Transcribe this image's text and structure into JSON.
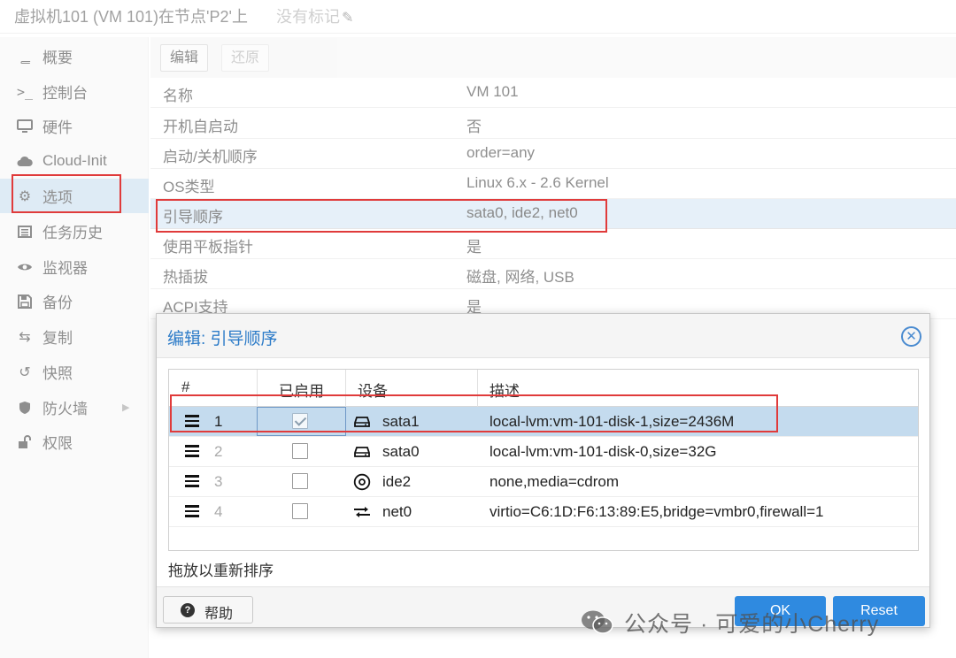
{
  "window": {
    "title": "虚拟机101 (VM 101)在节点'P2'上",
    "tags_label": "没有标记"
  },
  "nav": {
    "items": [
      {
        "label": "概要",
        "icon": "book-icon"
      },
      {
        "label": "控制台",
        "icon": "terminal-icon"
      },
      {
        "label": "硬件",
        "icon": "monitor-icon"
      },
      {
        "label": "Cloud-Init",
        "icon": "cloud-icon"
      },
      {
        "label": "选项",
        "icon": "gear-icon"
      },
      {
        "label": "任务历史",
        "icon": "list-icon"
      },
      {
        "label": "监视器",
        "icon": "eye-icon"
      },
      {
        "label": "备份",
        "icon": "floppy-icon"
      },
      {
        "label": "复制",
        "icon": "retweet-icon"
      },
      {
        "label": "快照",
        "icon": "history-icon"
      },
      {
        "label": "防火墙",
        "icon": "shield-icon"
      },
      {
        "label": "权限",
        "icon": "unlock-icon"
      }
    ]
  },
  "toolbar": {
    "edit_label": "编辑",
    "revert_label": "还原"
  },
  "options": {
    "rows": [
      {
        "key": "名称",
        "value": "VM 101"
      },
      {
        "key": "开机自启动",
        "value": "否"
      },
      {
        "key": "启动/关机顺序",
        "value": "order=any"
      },
      {
        "key": "OS类型",
        "value": "Linux 6.x - 2.6 Kernel"
      },
      {
        "key": "引导顺序",
        "value": "sata0, ide2, net0"
      },
      {
        "key": "使用平板指针",
        "value": "是"
      },
      {
        "key": "热插拔",
        "value": "磁盘, 网络, USB"
      },
      {
        "key": "ACPI支持",
        "value": "是"
      }
    ]
  },
  "dialog": {
    "title": "编辑: 引导顺序",
    "columns": {
      "num": "#",
      "enabled": "已启用",
      "device": "设备",
      "description": "描述"
    },
    "rows": [
      {
        "num": "1",
        "enabled": true,
        "device": "sata1",
        "device_icon": "hdd-icon",
        "description": "local-lvm:vm-101-disk-1,size=2436M"
      },
      {
        "num": "2",
        "enabled": false,
        "device": "sata0",
        "device_icon": "hdd-icon",
        "description": "local-lvm:vm-101-disk-0,size=32G"
      },
      {
        "num": "3",
        "enabled": false,
        "device": "ide2",
        "device_icon": "cdrom-icon",
        "description": "none,media=cdrom"
      },
      {
        "num": "4",
        "enabled": false,
        "device": "net0",
        "device_icon": "exchange-icon",
        "description": "virtio=C6:1D:F6:13:89:E5,bridge=vmbr0,firewall=1"
      }
    ],
    "hint": "拖放以重新排序",
    "help_label": "帮助",
    "ok_label": "OK",
    "reset_label": "Reset"
  },
  "watermark": {
    "text": "公众号 · 可爱的小Cherry"
  },
  "colors": {
    "accent": "#2f8ae0",
    "selection": "#c4dbee",
    "highlight_border": "#e03b3b",
    "dialog_title": "#2c7bc8"
  }
}
